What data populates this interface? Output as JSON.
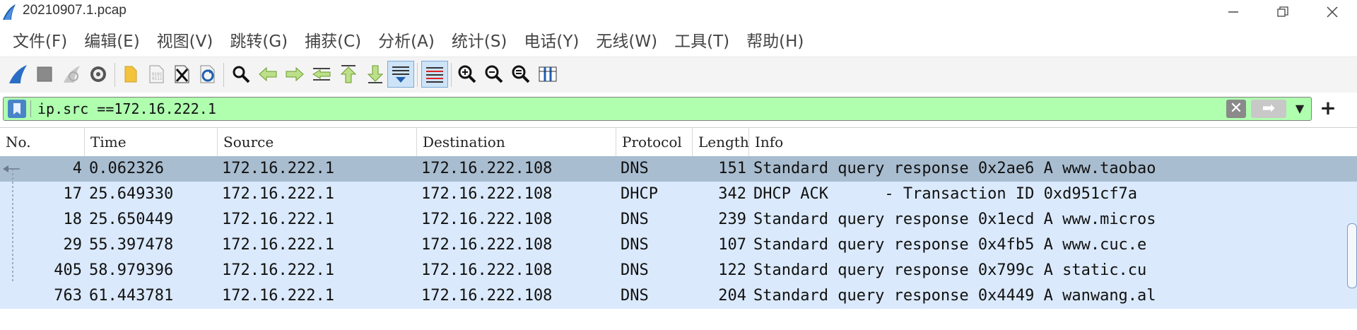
{
  "window": {
    "title": "20210907.1.pcap",
    "controls": {
      "minimize": "—",
      "restore": "❐",
      "close": "✕"
    }
  },
  "menu": [
    "文件(F)",
    "编辑(E)",
    "视图(V)",
    "跳转(G)",
    "捕获(C)",
    "分析(A)",
    "统计(S)",
    "电话(Y)",
    "无线(W)",
    "工具(T)",
    "帮助(H)"
  ],
  "toolbar": {
    "icons": [
      "shark-fin-icon",
      "stop-icon",
      "restart-icon",
      "options-gear-icon",
      "open-folder-icon",
      "file-icon",
      "close-file-icon",
      "reload-icon",
      "find-icon",
      "back-icon",
      "forward-icon",
      "goto-packet-icon",
      "first-packet-icon",
      "last-packet-icon",
      "autoscroll-icon",
      "colorize-icon",
      "zoom-in-icon",
      "zoom-out-icon",
      "zoom-reset-icon",
      "resize-columns-icon"
    ]
  },
  "filter": {
    "value": "ip.src ==172.16.222.1",
    "background": "#afffaf"
  },
  "columns": [
    "No.",
    "Time",
    "Source",
    "Destination",
    "Protocol",
    "Length",
    "Info"
  ],
  "packets": [
    {
      "no": "4",
      "time": "0.062326",
      "source": "172.16.222.1",
      "destination": "172.16.222.108",
      "protocol": "DNS",
      "length": "151",
      "info": "Standard query response 0x2ae6 A www.taobao"
    },
    {
      "no": "17",
      "time": "25.649330",
      "source": "172.16.222.1",
      "destination": "172.16.222.108",
      "protocol": "DHCP",
      "length": "342",
      "info": "DHCP ACK      - Transaction ID 0xd951cf7a"
    },
    {
      "no": "18",
      "time": "25.650449",
      "source": "172.16.222.1",
      "destination": "172.16.222.108",
      "protocol": "DNS",
      "length": "239",
      "info": "Standard query response 0x1ecd A www.micros"
    },
    {
      "no": "29",
      "time": "55.397478",
      "source": "172.16.222.1",
      "destination": "172.16.222.108",
      "protocol": "DNS",
      "length": "107",
      "info": "Standard query response 0x4fb5 A www.cuc.e"
    },
    {
      "no": "405",
      "time": "58.979396",
      "source": "172.16.222.1",
      "destination": "172.16.222.108",
      "protocol": "DNS",
      "length": "122",
      "info": "Standard query response 0x799c A static.cu"
    },
    {
      "no": "763",
      "time": "61.443781",
      "source": "172.16.222.1",
      "destination": "172.16.222.108",
      "protocol": "DNS",
      "length": "204",
      "info": "Standard query response 0x4449 A wanwang.al"
    }
  ],
  "colors": {
    "selected_row": "#a9bdd0",
    "udp_row": "#dae9fb",
    "filter_ok": "#afffaf"
  }
}
